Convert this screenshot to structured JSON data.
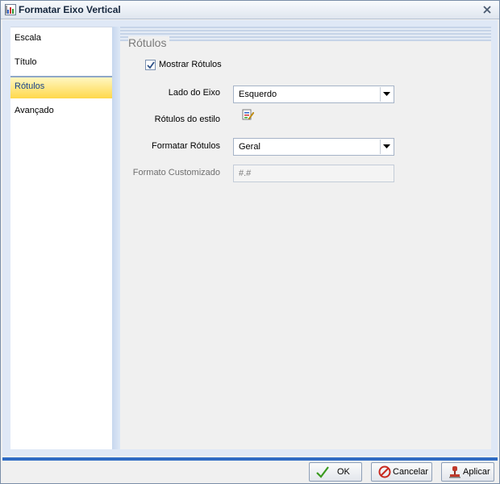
{
  "window": {
    "title": "Formatar Eixo Vertical",
    "close_symbol": "×"
  },
  "sidebar": {
    "items": [
      {
        "label": "Escala",
        "active": false
      },
      {
        "label": "Título",
        "active": false
      },
      {
        "label": "Rótulos",
        "active": true
      },
      {
        "label": "Avançado",
        "active": false
      }
    ]
  },
  "panel": {
    "title": "Rótulos",
    "show_labels": {
      "label": "Mostrar Rótulos",
      "checked": true
    },
    "axis_side": {
      "label": "Lado do Eixo",
      "value": "Esquerdo"
    },
    "label_style": {
      "label": "Rótulos do estilo",
      "icon": "style-edit-icon"
    },
    "format_labels": {
      "label": "Formatar Rótulos",
      "value": "Geral"
    },
    "custom_format": {
      "label": "Formato Customizado",
      "value": "#.#"
    }
  },
  "footer": {
    "ok_label": "OK",
    "cancel_label": "Cancelar",
    "apply_label": "Aplicar"
  },
  "colors": {
    "accent": "#2e6bc4",
    "active_tab": "#ffd84a",
    "panel_bg": "#f0f0f0"
  }
}
